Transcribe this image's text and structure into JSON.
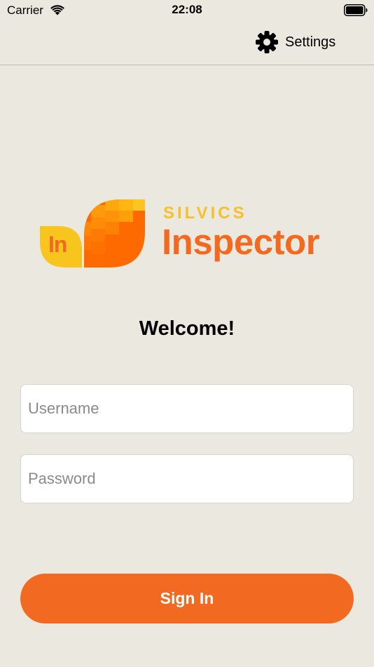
{
  "status_bar": {
    "carrier": "Carrier",
    "time": "22:08",
    "wifi_icon": "wifi-icon",
    "battery_icon": "battery-icon"
  },
  "nav": {
    "settings_label": "Settings",
    "settings_icon": "gear-icon"
  },
  "logo": {
    "mark_text": "In",
    "brand_small": "SILVICS",
    "brand_large": "Inspector",
    "colors": {
      "orange": "#f26a21",
      "yellow": "#f7c02a"
    }
  },
  "main": {
    "welcome": "Welcome!",
    "username": {
      "value": "",
      "placeholder": "Username"
    },
    "password": {
      "value": "",
      "placeholder": "Password"
    },
    "sign_in_label": "Sign In"
  },
  "theme": {
    "background": "#ebe9df",
    "accent": "#f26a21"
  }
}
